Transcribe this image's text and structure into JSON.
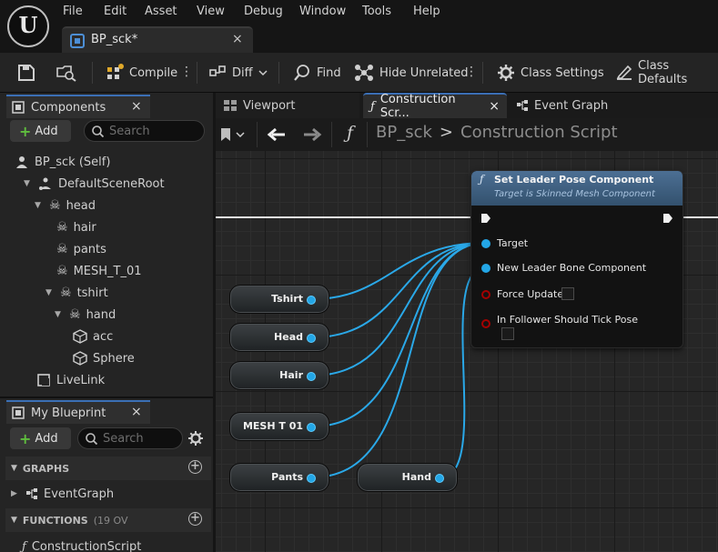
{
  "menu": {
    "logo": "U",
    "items": [
      "File",
      "Edit",
      "Asset",
      "View",
      "Debug",
      "Window",
      "Tools",
      "Help"
    ]
  },
  "document_tab": {
    "label": "BP_sck*",
    "close": "×"
  },
  "toolbar": {
    "compile_label": "Compile",
    "diff_label": "Diff",
    "find_label": "Find",
    "hide_unrelated_label": "Hide Unrelated",
    "class_settings_label": "Class Settings",
    "class_defaults_label": "Class Defaults",
    "more": "⋮"
  },
  "components_panel": {
    "title": "Components",
    "close": "×",
    "add_label": "Add",
    "plus": "+",
    "search_placeholder": "Search",
    "tree": [
      {
        "label": "BP_sck (Self)"
      },
      {
        "label": "DefaultSceneRoot"
      },
      {
        "label": "head"
      },
      {
        "label": "hair"
      },
      {
        "label": "pants"
      },
      {
        "label": "MESH_T_01"
      },
      {
        "label": "tshirt"
      },
      {
        "label": "hand"
      },
      {
        "label": "acc"
      },
      {
        "label": "Sphere"
      },
      {
        "label": "LiveLink"
      }
    ]
  },
  "my_blueprint_panel": {
    "title": "My Blueprint",
    "close": "×",
    "add_label": "Add",
    "plus": "+",
    "search_placeholder": "Search",
    "graphs_header": "GRAPHS",
    "event_graph_label": "EventGraph",
    "functions_header": "FUNCTIONS",
    "functions_count": "(19 OV",
    "construction_script_label": "ConstructionScript"
  },
  "graph_tabs": {
    "viewport": "Viewport",
    "construction_script": "Construction Scr...",
    "event_graph": "Event Graph",
    "close": "×"
  },
  "breadcrumb": {
    "blueprint": "BP_sck",
    "separator": ">",
    "graph": "Construction Script"
  },
  "call_node": {
    "title": "Set Leader Pose Component",
    "subtitle": "Target is Skinned Mesh Component",
    "pins": {
      "target": "Target",
      "new_leader": "New Leader Bone Component",
      "force_update": "Force Update",
      "follower_tick": "In Follower Should Tick Pose"
    }
  },
  "variable_nodes": {
    "tshirt": "Tshirt",
    "head": "Head",
    "hair": "Hair",
    "mesh": "MESH T 01",
    "pants": "Pants",
    "hand": "Hand"
  },
  "colors": {
    "object_pin": "#23a6e6",
    "bool_pin": "#a30000",
    "node_header": "#4c6f94",
    "accent_tab": "#3b6fb5",
    "add_plus": "#5fbd3e"
  }
}
